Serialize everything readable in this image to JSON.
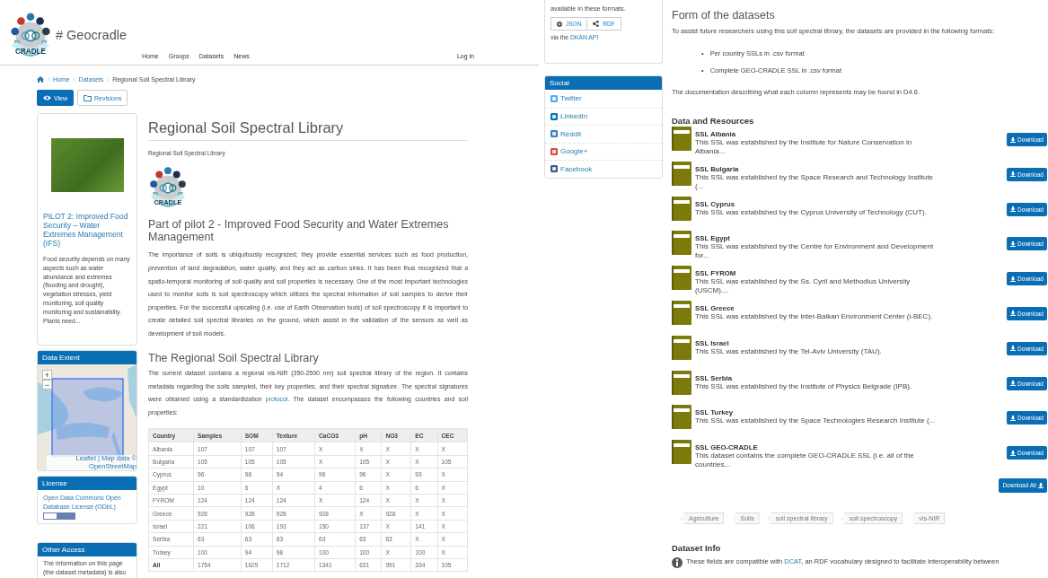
{
  "header": {
    "logo_text": "CRADLE",
    "title": "# Geocradle",
    "nav": [
      {
        "label": "Home"
      },
      {
        "label": "Groups"
      },
      {
        "label": "Datasets"
      },
      {
        "label": "News"
      }
    ],
    "login": "Log in"
  },
  "breadcrumb": [
    "Home",
    "Datasets",
    "Regional Soil Spectral Library"
  ],
  "breadcrumb_separator": "/",
  "view_tabs": [
    {
      "label": "View",
      "kind": "view",
      "selected": true
    },
    {
      "label": "Revisions",
      "kind": "revisions",
      "selected": false
    }
  ],
  "pilot_card": {
    "title": "PILOT 2: Improved Food Security – Water Extremes Management (IFS)",
    "description": "Food security depends on many aspects such as water abundance and extremes (flooding and drought), vegetation stresses, yield monitoring, soil quality monitoring and sustainability. Plants need..."
  },
  "data_extent": {
    "title": "Data Extent",
    "zoom_in": "+",
    "zoom_out": "−",
    "attribution": "Leaflet | Map data © OpenStreetMap"
  },
  "license": {
    "title": "License",
    "link": "Open Data Commons Open Database License (ODbL)"
  },
  "other_access": {
    "title": "Other Access",
    "text": "The information on this page (the dataset metadata) is also",
    "formats_text": "available in these formats.",
    "formats": [
      {
        "label": "JSON",
        "kind": "json"
      },
      {
        "label": "RDF",
        "kind": "rdf"
      }
    ],
    "api_prefix": "via the ",
    "api_link": "DKAN API"
  },
  "social": {
    "title": "Social",
    "items": [
      {
        "label": "Twitter",
        "kind": "twitter"
      },
      {
        "label": "LinkedIn",
        "kind": "linkedin"
      },
      {
        "label": "Reddit",
        "kind": "reddit"
      },
      {
        "label": "Google+",
        "kind": "google"
      },
      {
        "label": "Facebook",
        "kind": "facebook"
      }
    ]
  },
  "dataset": {
    "title": "Regional Soil Spectral Library",
    "subtitle": "Regional Soil Spectral Library",
    "logo_text": "CRADLE",
    "heading_1": "Part of pilot 2 - Improved Food Security and Water Extremes Management",
    "text_1": "The importance of soils is ubiquitously recognized; they provide essential services such as food production, prevention of land degradation, water quality, and they act as carbon sinks. It has been thus recognized that a spatio-temporal monitoring of soil quality and soil properties is necessary. One of the most important technologies used to monitor soils is soil spectroscopy which utilizes the spectral information of soil samples to derive their properties. For the successful upscaling (i.e. use of Earth Observation tools) of soil spectroscopy it is important to create detailed soil spectral libraries on the ground, which assist in the validation of the sensors as well as development of soil models.",
    "heading_2": "The Regional Soil Spectral Library",
    "text_2_before": "The current dataset contains a regional vis-NIR (350-2500 nm) soil spectral library of the region. It contains metadata regarding the soils sampled, their key properties, and their spectral signature. The spectral signatures were obtained using a standardization ",
    "text_2_link": "protocol",
    "text_2_after": ". The dataset encompasses the following countries and soil properties:"
  },
  "table": {
    "columns": [
      "Country",
      "Samples",
      "SOM",
      "Texture",
      "CaCO3",
      "pH",
      "NO3",
      "EC",
      "CEC"
    ],
    "rows": [
      {
        "kind": "country",
        "cells": [
          "Albania",
          "107",
          "107",
          "107",
          "X",
          "X",
          "X",
          "X",
          "X"
        ]
      },
      {
        "kind": "country",
        "cells": [
          "Bulgaria",
          "105",
          "105",
          "105",
          "X",
          "105",
          "X",
          "X",
          "105"
        ]
      },
      {
        "kind": "country",
        "cells": [
          "Cyprus",
          "96",
          "96",
          "94",
          "96",
          "96",
          "X",
          "93",
          "X"
        ]
      },
      {
        "kind": "country",
        "cells": [
          "Egypt",
          "10",
          "6",
          "X",
          "4",
          "6",
          "X",
          "6",
          "X"
        ]
      },
      {
        "kind": "country",
        "cells": [
          "FYROM",
          "124",
          "124",
          "124",
          "X",
          "124",
          "X",
          "X",
          "X"
        ]
      },
      {
        "kind": "country",
        "cells": [
          "Greece",
          "928",
          "928",
          "928",
          "928",
          "X",
          "928",
          "X",
          "X"
        ]
      },
      {
        "kind": "country",
        "cells": [
          "Israel",
          "221",
          "106",
          "193",
          "150",
          "137",
          "X",
          "141",
          "X"
        ]
      },
      {
        "kind": "country",
        "cells": [
          "Serbia",
          "63",
          "63",
          "63",
          "63",
          "63",
          "63",
          "X",
          "X"
        ]
      },
      {
        "kind": "country",
        "cells": [
          "Turkey",
          "100",
          "94",
          "98",
          "100",
          "100",
          "X",
          "100",
          "X"
        ]
      },
      {
        "kind": "total",
        "cells": [
          "All",
          "1754",
          "1629",
          "1712",
          "1341",
          "631",
          "991",
          "334",
          "105"
        ]
      }
    ]
  },
  "form": {
    "heading": "Form of the datasets",
    "intro": "To assist future researchers using this soil spectral library, the datasets are provided in the following formats:",
    "bullet_marker": "•",
    "bullets": [
      "Per country SSLs in .csv format",
      "Complete GEO-CRADLE SSL in .csv format"
    ],
    "documentation": "The documentation describing what each column represents may be found in D4.6."
  },
  "resources": {
    "heading": "Data and Resources",
    "items": [
      {
        "name": "SSL Albania",
        "description": "This SSL was established by the Institute for Nature Conservation in Albania...",
        "button": "Download"
      },
      {
        "name": "SSL Bulgaria",
        "description": "This SSL was established by the Space Research and Technology Institute (...",
        "button": "Download"
      },
      {
        "name": "SSL Cyprus",
        "description": "This SSL was established by the Cyprus University of Technology (CUT).",
        "button": "Download"
      },
      {
        "name": "SSL Egypt",
        "description": "This SSL was established by the Centre for Environment and Development for...",
        "button": "Download"
      },
      {
        "name": "SSL FYROM",
        "description": "This SSL was established by the Ss. Cyril and Methodius University (USCM)....",
        "button": "Download"
      },
      {
        "name": "SSL Greece",
        "description": "This SSL was established by the inter-Balkan Environment Center (i-BEC).",
        "button": "Download"
      },
      {
        "name": "SSL Israel",
        "description": "This SSL was established by the Tel-Aviv University (TAU).",
        "button": "Download"
      },
      {
        "name": "SSL Serbia",
        "description": "This SSL was established by the Institute of Physics Belgrade (IPB).",
        "button": "Download"
      },
      {
        "name": "SSL Turkey",
        "description": "This SSL was established by the Space Technologies Research Institute (...",
        "button": "Download"
      },
      {
        "name": "SSL GEO-CRADLE",
        "description": "This dataset contains the complete GEO-CRADLE SSL (i.e. all of the countries...",
        "button": "Download"
      }
    ],
    "download_all": "Download All"
  },
  "tags": [
    "Agriculture",
    "Soils",
    "soil spectral library",
    "soil spectroscopy",
    "vis-NIR"
  ],
  "dataset_info": {
    "heading": "Dataset Info",
    "text_before": "These fields are compatible with ",
    "link": "DCAT",
    "text_after": ", an RDF vocabulary designed to facilitate interoperability between"
  }
}
